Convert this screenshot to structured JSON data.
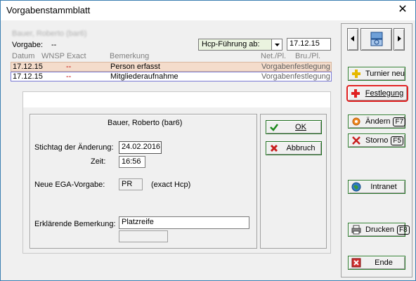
{
  "window": {
    "title": "Vorgabenstammblatt",
    "close_glyph": "✕"
  },
  "header": {
    "person_name": "Bauer, Roberto (bar6)",
    "vorgabe_label": "Vorgabe:",
    "vorgabe_value": "--",
    "hcp_select": "Hcp-Führung ab:",
    "hcp_date": "17.12.15"
  },
  "table": {
    "columns": [
      "Datum",
      "WNSP",
      "Exact",
      "Bemerkung",
      "Net./Pl.",
      "Bru./Pl."
    ],
    "rows": [
      {
        "datum": "17.12.15",
        "wnsp": "--",
        "bemerkung": "Person erfasst",
        "info": "Vorgabenfestlegung"
      },
      {
        "datum": "17.12.15",
        "wnsp": "--",
        "bemerkung": "Mitgliederaufnahme",
        "info": "Vorgabenfestlegung"
      }
    ]
  },
  "dialog": {
    "person": "Bauer, Roberto (bar6)",
    "stichtag_label": "Stichtag der Änderung:",
    "stichtag_value": "24.02.2016",
    "zeit_label": "Zeit:",
    "zeit_value": "16:56",
    "ega_label": "Neue EGA-Vorgabe:",
    "ega_value": "PR",
    "ega_suffix": "(exact Hcp)",
    "bemerkung_label": "Erklärende Bemerkung:",
    "bemerkung_value": "Platzreife",
    "bemerkung_value2": "",
    "ok_label": "OK",
    "abbruch_label": "Abbruch"
  },
  "sidebar": {
    "turnier_label": "Turnier neu",
    "festlegung_label": "Festlegung",
    "aendern_label": "Ändern",
    "aendern_key": "F7",
    "storno_label": "Storno",
    "storno_key": "F5",
    "intranet_label": "Intranet",
    "drucken_label": "Drucken",
    "drucken_key": "F8",
    "ende_label": "Ende"
  },
  "colors": {
    "selected_row": "#f4dccb",
    "focus_row_border": "#7b7bd6",
    "highlight_border": "#e02020",
    "ok_green": "#1d8a1d",
    "cancel_red": "#c81e1e"
  }
}
